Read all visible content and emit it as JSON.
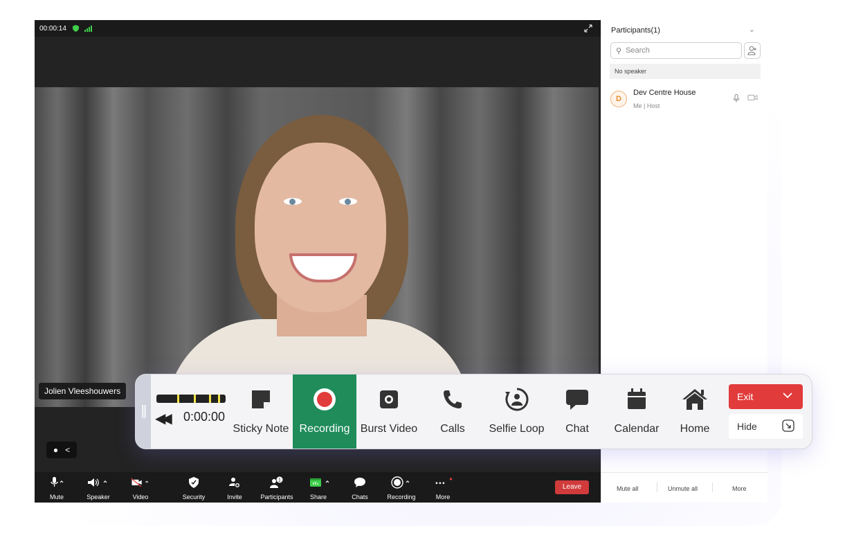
{
  "meeting": {
    "elapsed_time": "00:00:14",
    "participant_name_tag": "Jolien Vleeshouwers",
    "toolbar": [
      {
        "label": "Mute",
        "icon": "microphone-icon"
      },
      {
        "label": "Speaker",
        "icon": "speaker-icon"
      },
      {
        "label": "Video",
        "icon": "video-off-icon"
      },
      {
        "label": "Security",
        "icon": "shield-icon"
      },
      {
        "label": "Invite",
        "icon": "invite-user-icon"
      },
      {
        "label": "Participants",
        "icon": "participants-icon",
        "badge": "1"
      },
      {
        "label": "Share",
        "icon": "share-screen-icon"
      },
      {
        "label": "Chats",
        "icon": "chat-icon"
      },
      {
        "label": "Recording",
        "icon": "record-icon"
      },
      {
        "label": "More",
        "icon": "more-icon"
      }
    ],
    "leave_label": "Leave"
  },
  "participants_panel": {
    "title": "Participants(1)",
    "search_placeholder": "Search",
    "speaker_status": "No speaker",
    "participant": {
      "initial": "D",
      "name": "Dev Centre House",
      "role": "Me | Host"
    },
    "footer": {
      "mute_all": "Mute all",
      "unmute_all": "Unmute all",
      "more": "More"
    }
  },
  "dock": {
    "timer": "0:00:00",
    "tools": [
      {
        "label": "Sticky Note",
        "icon": "sticky-note-icon"
      },
      {
        "label": "Recording",
        "icon": "record-icon",
        "active": true
      },
      {
        "label": "Burst Video",
        "icon": "camera-icon"
      },
      {
        "label": "Calls",
        "icon": "phone-icon"
      },
      {
        "label": "Selfie Loop",
        "icon": "selfie-loop-icon"
      },
      {
        "label": "Chat",
        "icon": "chat-bubble-icon"
      },
      {
        "label": "Calendar",
        "icon": "calendar-icon"
      },
      {
        "label": "Home",
        "icon": "home-icon"
      }
    ],
    "exit_label": "Exit",
    "hide_label": "Hide"
  },
  "colors": {
    "active_tool": "#1f8c5a",
    "exit": "#e23b3b",
    "leave": "#d13b3b",
    "timeline_marker": "#f2e14a"
  }
}
